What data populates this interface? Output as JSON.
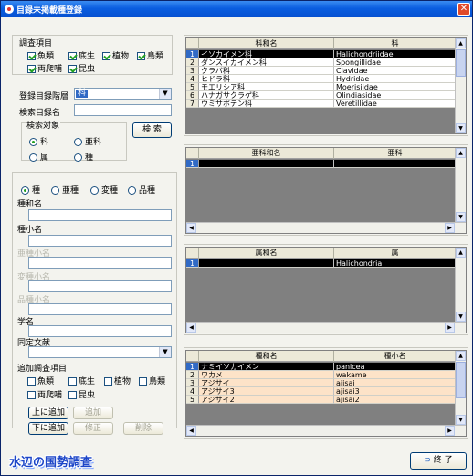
{
  "window": {
    "title": "目録未掲載種登録",
    "close": "✕"
  },
  "survey": {
    "group_label": "調査項目",
    "items": [
      {
        "label": "魚類",
        "checked": true
      },
      {
        "label": "底生",
        "checked": true
      },
      {
        "label": "植物",
        "checked": true
      },
      {
        "label": "鳥類",
        "checked": true
      },
      {
        "label": "両爬哺",
        "checked": true
      },
      {
        "label": "昆虫",
        "checked": true
      }
    ]
  },
  "level": {
    "label": "登録目録階層",
    "value": "科"
  },
  "search": {
    "name_label": "検索目録名",
    "name_value": "",
    "target_label": "検索対象",
    "targets": [
      "科",
      "亜科",
      "属",
      "種"
    ],
    "button": "検 索"
  },
  "register": {
    "ranks": [
      "種",
      "亜種",
      "変種",
      "品種"
    ],
    "fields": [
      {
        "label": "種和名",
        "value": "",
        "disabled": false
      },
      {
        "label": "種小名",
        "value": "",
        "disabled": false
      },
      {
        "label": "亜種小名",
        "value": "",
        "disabled": true
      },
      {
        "label": "変種小名",
        "value": "",
        "disabled": true
      },
      {
        "label": "品種小名",
        "value": "",
        "disabled": true
      },
      {
        "label": "学名",
        "value": "",
        "disabled": false
      }
    ],
    "literature_label": "同定文献",
    "literature_value": "",
    "extra_label": "追加調査項目",
    "extra_items": [
      {
        "label": "魚類",
        "checked": false
      },
      {
        "label": "底生",
        "checked": false
      },
      {
        "label": "植物",
        "checked": false
      },
      {
        "label": "鳥類",
        "checked": false
      },
      {
        "label": "両爬哺",
        "checked": false
      },
      {
        "label": "昆虫",
        "checked": false
      }
    ],
    "buttons": {
      "add_above": "上に追加",
      "add": "追加",
      "add_below": "下に追加",
      "modify": "修正",
      "delete": "削除"
    }
  },
  "family_grid": {
    "headers": [
      "科和名",
      "科"
    ],
    "rows": [
      {
        "n": "1",
        "jp": "イソカイメン科",
        "sci": "Halichondriidae",
        "selected": true
      },
      {
        "n": "2",
        "jp": "ダンスイカイメン科",
        "sci": "Spongillidae"
      },
      {
        "n": "3",
        "jp": "クラバ科",
        "sci": "Clavidae"
      },
      {
        "n": "4",
        "jp": "ヒドラ科",
        "sci": "Hydridae"
      },
      {
        "n": "5",
        "jp": "モエリシア科",
        "sci": "Moerisiidae"
      },
      {
        "n": "6",
        "jp": "ハナガサクラゲ科",
        "sci": "Olindiasidae"
      },
      {
        "n": "7",
        "jp": "ウミサボテン科",
        "sci": "Veretillidae"
      }
    ]
  },
  "subfamily_grid": {
    "headers": [
      "亜科和名",
      "亜科"
    ],
    "rows": [
      {
        "n": "1",
        "jp": "",
        "sci": "",
        "selected": true
      }
    ]
  },
  "genus_grid": {
    "headers": [
      "属和名",
      "属"
    ],
    "rows": [
      {
        "n": "1",
        "jp": "",
        "sci": "Halichondria",
        "selected": true
      }
    ]
  },
  "species_grid": {
    "headers": [
      "種和名",
      "種小名"
    ],
    "rows": [
      {
        "n": "1",
        "jp": "ナミイソカイメン",
        "sci": "panicea",
        "selected": true
      },
      {
        "n": "2",
        "jp": "ワカメ",
        "sci": "wakame",
        "peach": true
      },
      {
        "n": "3",
        "jp": "アジサイ",
        "sci": "ajisai",
        "peach": true
      },
      {
        "n": "4",
        "jp": "アジサイ3",
        "sci": "ajisai3",
        "peach": true
      },
      {
        "n": "5",
        "jp": "アジサイ2",
        "sci": "ajisai2",
        "peach": true
      }
    ]
  },
  "footer": {
    "logo": "水辺の国勢調査",
    "exit": "終 了"
  },
  "icons": [
    "window-icon",
    "close-icon",
    "dropdown-arrow-icon",
    "scroll-up-icon",
    "scroll-down-icon",
    "scroll-left-icon",
    "scroll-right-icon",
    "exit-icon"
  ]
}
